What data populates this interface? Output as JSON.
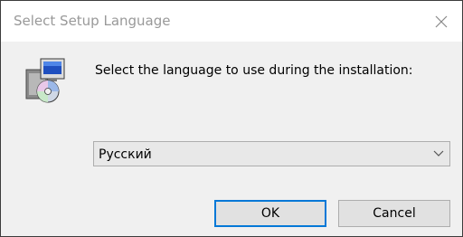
{
  "window": {
    "title": "Select Setup Language"
  },
  "icons": {
    "close": "close-icon",
    "setup": "setup-computer-disc-icon",
    "dropdown": "chevron-down-icon"
  },
  "prompt": {
    "text": "Select the language to use during the installation:"
  },
  "language_select": {
    "selected": "Русский"
  },
  "buttons": {
    "ok_label": "OK",
    "cancel_label": "Cancel"
  },
  "colors": {
    "accent": "#0078d7",
    "title_text": "#999999",
    "dialog_bg": "#f0f0f0"
  }
}
